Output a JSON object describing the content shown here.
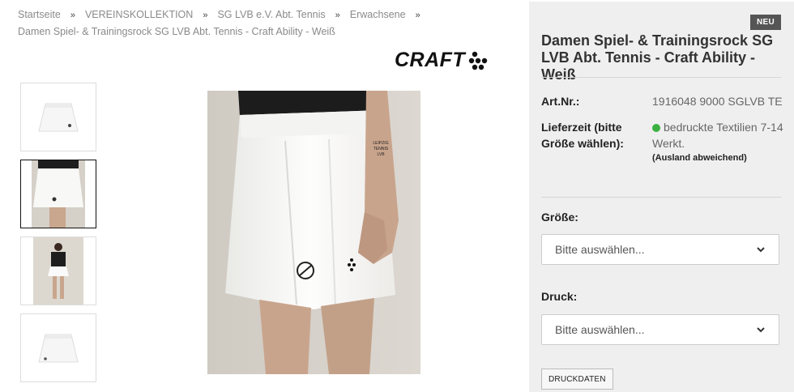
{
  "breadcrumb": {
    "items": [
      "Startseite",
      "VEREINSKOLLEKTION",
      "SG LVB e.V. Abt. Tennis",
      "Erwachsene"
    ],
    "separator": "»",
    "current": "Damen Spiel- & Trainingsrock SG LVB Abt. Tennis - Craft Ability - Weiß"
  },
  "brand": {
    "name": "CRAFT",
    "icon": "craft-dots-logo"
  },
  "gallery": {
    "thumbnails": [
      {
        "icon": "skirt-flat-photo"
      },
      {
        "icon": "skirt-model-side-photo",
        "active": true
      },
      {
        "icon": "model-full-body-photo"
      },
      {
        "icon": "skirt-back-photo"
      }
    ],
    "main_image": {
      "icon": "skirt-model-photo",
      "print_text": "LEIPZIG TENNIS LVB"
    }
  },
  "product": {
    "badge": "NEU",
    "title": "Damen Spiel- & Trainingsrock SG LVB Abt. Tennis - Craft Ability - Weiß",
    "art_nr_label": "Art.Nr.:",
    "art_nr_value": "1916048 9000 SGLVB TE",
    "delivery_label": "Lieferzeit (bitte Größe wählen):",
    "delivery_value": "bedruckte Textilien 7-14 Werkt.",
    "delivery_note": "(Ausland abweichend)",
    "delivery_status_color": "#3cb043"
  },
  "options": {
    "size_label": "Größe:",
    "size_select": "Bitte auswählen...",
    "print_label": "Druck:",
    "print_select": "Bitte auswählen...",
    "print_button": "DRUCKDATEN"
  }
}
